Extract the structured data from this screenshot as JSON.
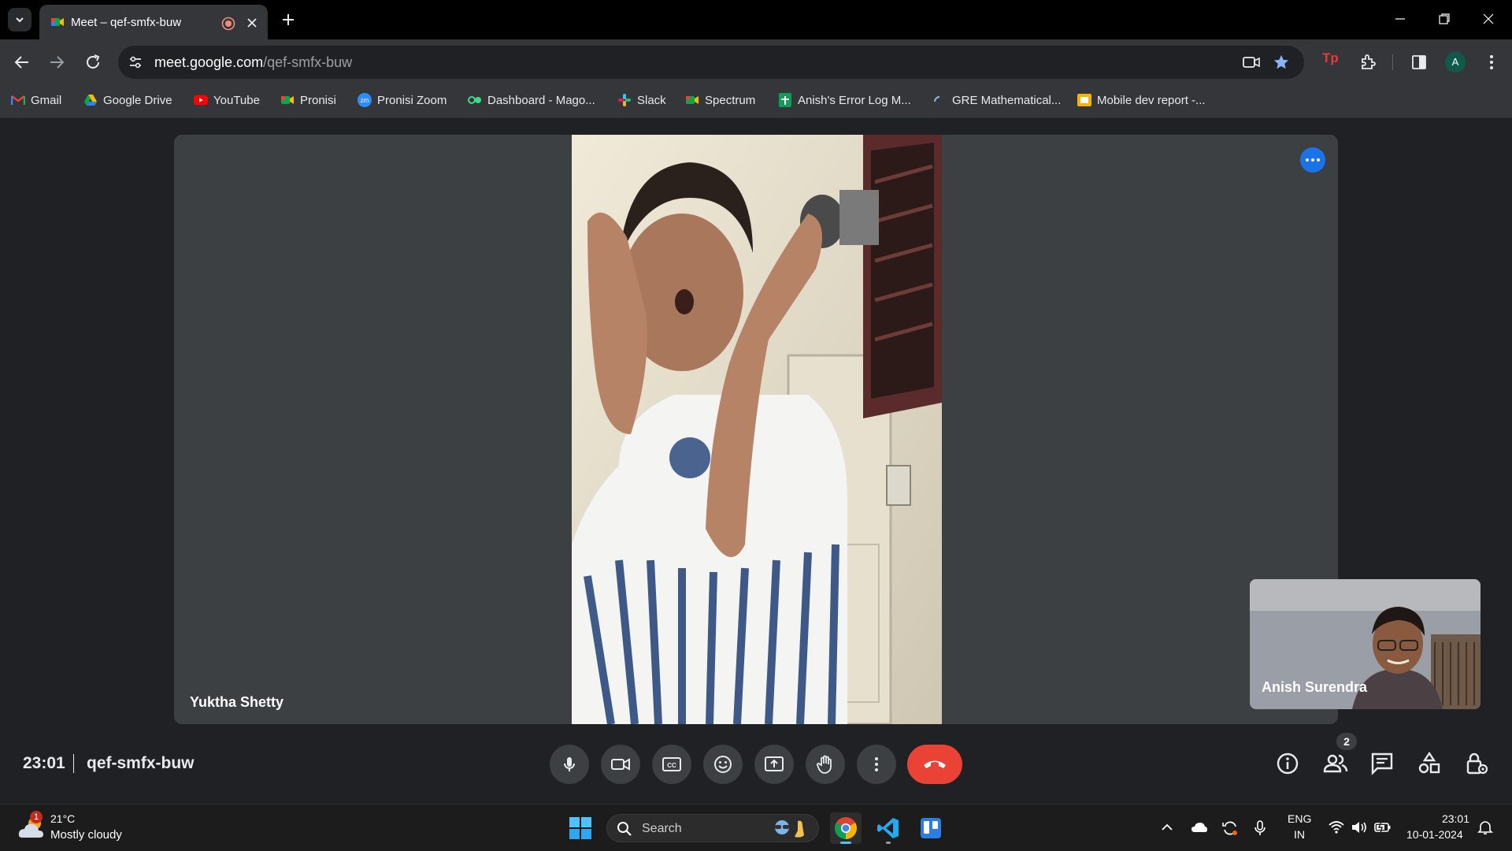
{
  "browser": {
    "tab_title": "Meet – qef-smfx-buw",
    "url_host": "meet.google.com",
    "url_path": "/qef-smfx-buw",
    "profile_initial": "A",
    "bookmarks": [
      {
        "label": "Gmail",
        "icon": "gmail-icon"
      },
      {
        "label": "Google Drive",
        "icon": "google-drive-icon"
      },
      {
        "label": "YouTube",
        "icon": "youtube-icon"
      },
      {
        "label": "Pronisi",
        "icon": "meet-icon"
      },
      {
        "label": "Pronisi Zoom",
        "icon": "zoom-icon"
      },
      {
        "label": "Dashboard - Mago...",
        "icon": "dashboard-icon"
      },
      {
        "label": "Slack",
        "icon": "slack-icon"
      },
      {
        "label": "Spectrum",
        "icon": "meet-icon"
      },
      {
        "label": "Anish's Error Log M...",
        "icon": "sheets-icon"
      },
      {
        "label": "GRE Mathematical...",
        "icon": "loader-icon"
      },
      {
        "label": "Mobile dev report -...",
        "icon": "slides-icon"
      }
    ]
  },
  "meet": {
    "main_participant": "Yuktha Shetty",
    "self_participant": "Anish Surendra",
    "time": "23:01",
    "meeting_code": "qef-smfx-buw",
    "people_count": "2"
  },
  "taskbar": {
    "weather_badge": "1",
    "temperature": "21°C",
    "weather": "Mostly cloudy",
    "search_label": "Search",
    "lang_line1": "ENG",
    "lang_line2": "IN",
    "time": "23:01",
    "date": "10-01-2024"
  },
  "colors": {
    "meet_background": "#202124",
    "tile": "#3c4043",
    "hangup": "#ea4335",
    "accent": "#1a73e8",
    "taskbar": "#1c1c1c"
  }
}
